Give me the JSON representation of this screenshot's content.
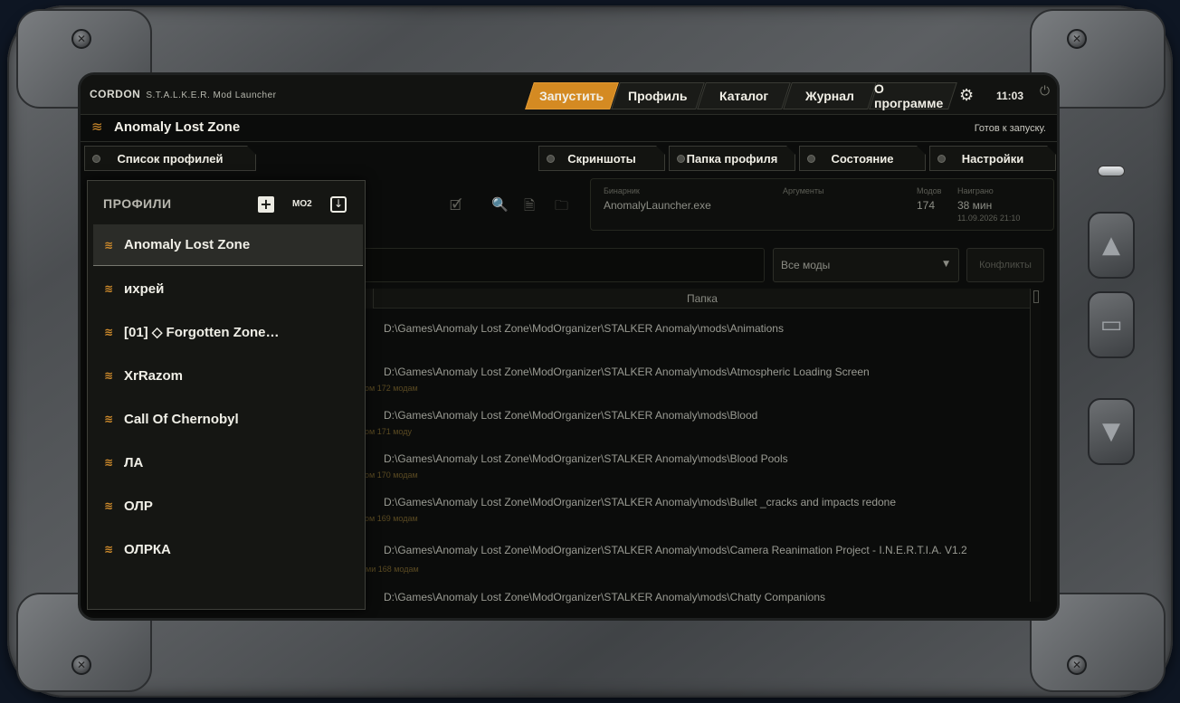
{
  "app": {
    "brand": "CORDON",
    "subtitle": "S.T.A.L.K.E.R. Mod Launcher",
    "clock": "11:03"
  },
  "nav": {
    "tabs": [
      "Запустить",
      "Профиль",
      "Каталог",
      "Журнал",
      "О программе"
    ]
  },
  "header": {
    "profile_title": "Anomaly Lost Zone",
    "status": "Готов к запуску."
  },
  "subtabs": {
    "profiles_list": "Список профилей",
    "screenshots": "Скриншоты",
    "profile_folder": "Папка профиля",
    "state": "Состояние",
    "settings": "Настройки"
  },
  "info": {
    "binary_label": "Бинарник",
    "binary_value": "AnomalyLauncher.exe",
    "args_label": "Аргументы",
    "mods_label": "Модов",
    "mods_value": "174",
    "played_label": "Наиграно",
    "played_value": "38 мин",
    "played_date": "11.09.2026 21:10"
  },
  "filter": {
    "select_value": "Все моды",
    "conflicts_label": "Конфликты"
  },
  "table": {
    "folder_header": "Папка",
    "rows": [
      "D:\\Games\\Anomaly Lost Zone\\ModOrganizer\\STALKER Anomaly\\mods\\Animations",
      "D:\\Games\\Anomaly Lost Zone\\ModOrganizer\\STALKER Anomaly\\mods\\Atmospheric Loading Screen",
      "D:\\Games\\Anomaly Lost Zone\\ModOrganizer\\STALKER Anomaly\\mods\\Blood",
      "D:\\Games\\Anomaly Lost Zone\\ModOrganizer\\STALKER Anomaly\\mods\\Blood Pools",
      "D:\\Games\\Anomaly Lost Zone\\ModOrganizer\\STALKER Anomaly\\mods\\Bullet _cracks and impacts redone",
      "D:\\Games\\Anomaly Lost Zone\\ModOrganizer\\STALKER Anomaly\\mods\\Camera Reanimation Project - I.N.E.R.T.I.A. V1.2",
      "D:\\Games\\Anomaly Lost Zone\\ModOrganizer\\STALKER Anomaly\\mods\\Chatty Companions"
    ],
    "ghost_notes": [
      "ом 172 модам",
      "ом 171 моду",
      "ом 170 модам",
      "ом 169 модам",
      "ами 168 модам"
    ]
  },
  "profiles_panel": {
    "heading": "ПРОФИЛИ",
    "mo2_label": "MO2",
    "items": [
      "Anomaly Lost Zone",
      "ихрей",
      "[01] ◇ Forgotten Zone…",
      "XrRazom",
      "Call Of Chernobyl",
      "ЛА",
      "ОЛР",
      "ОЛРКА"
    ]
  }
}
